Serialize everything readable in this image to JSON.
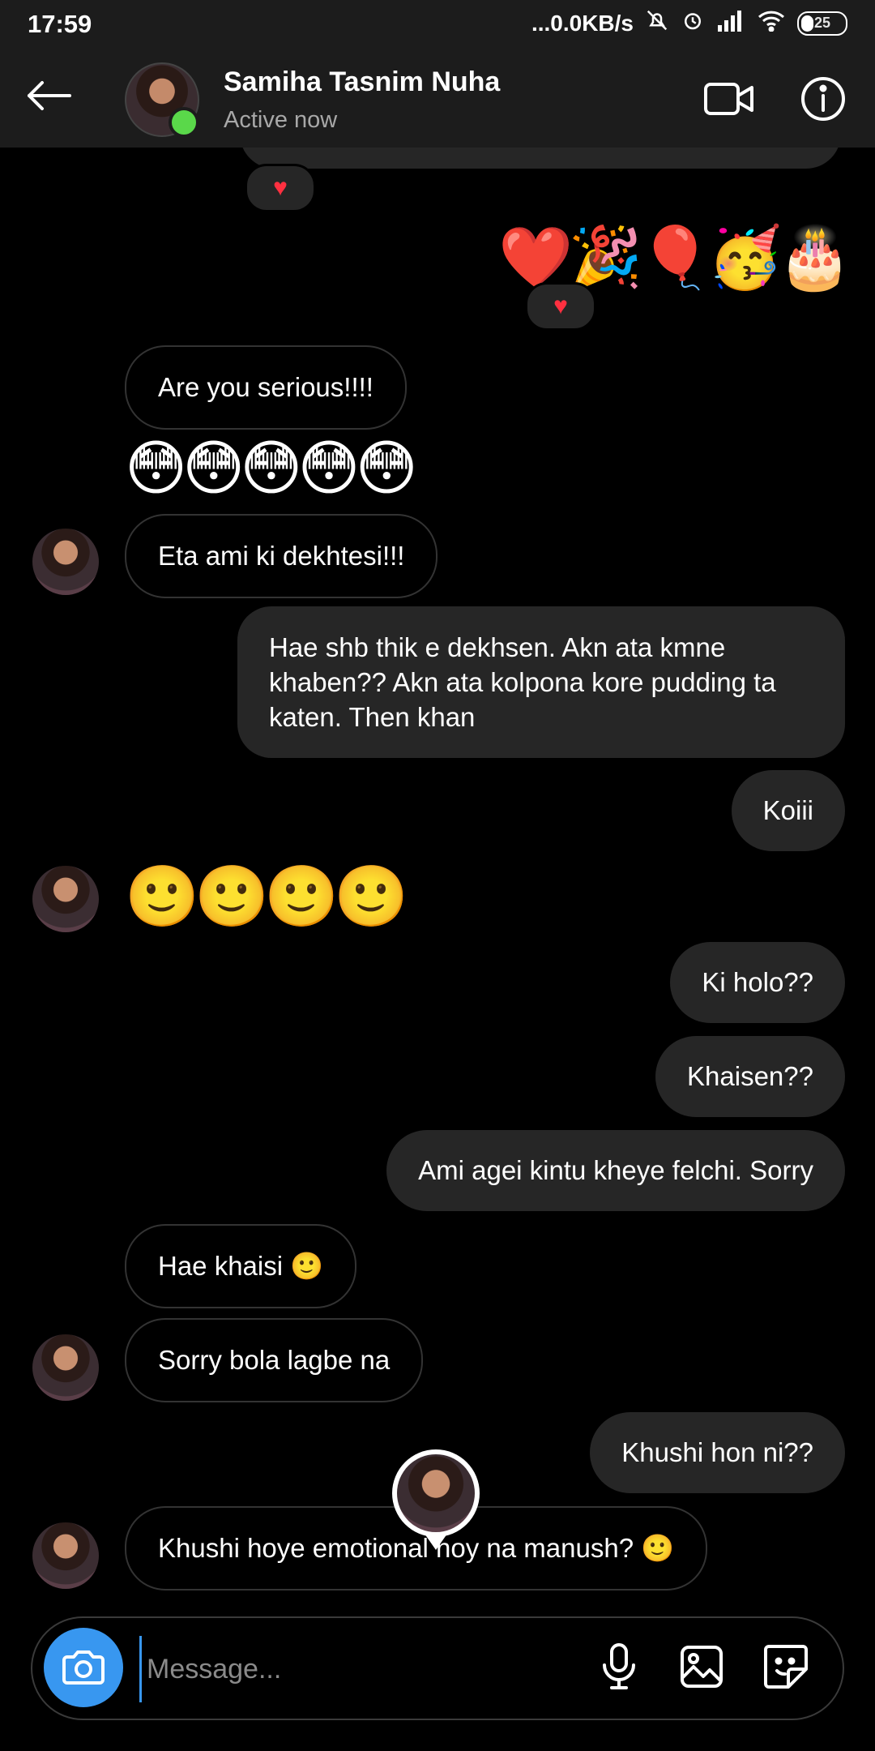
{
  "status_bar": {
    "time": "17:59",
    "network_speed": "...0.0KB/s",
    "battery": "25"
  },
  "header": {
    "name": "Samiha Tasnim Nuha",
    "status": "Active now"
  },
  "messages": {
    "reaction_1": "♥",
    "out_emojis_1": "❤️🎉🎈🥳🎂",
    "reaction_2": "♥",
    "in_1": "Are you serious!!!!",
    "in_emojis_1": "😳😳😳😳😳",
    "in_2": "Eta ami ki dekhtesi!!!",
    "out_1": "Hae shb thik e dekhsen. Akn ata kmne khaben?? Akn ata kolpona kore pudding ta katen. Then khan",
    "out_2": "Koiii",
    "in_emojis_2": "🙂🙂🙂🙂",
    "out_3": "Ki holo??",
    "out_4": "Khaisen??",
    "out_5": "Ami agei kintu kheye felchi. Sorry",
    "in_3": "Hae khaisi 🙂",
    "in_4": "Sorry bola lagbe na",
    "out_6": "Khushi hon ni??",
    "in_5": "Khushi hoye emotional hoy na manush? 🙂"
  },
  "composer": {
    "placeholder": "Message..."
  },
  "colors": {
    "background": "#000000",
    "header": "#1c1c1c",
    "outgoing_bubble": "#262626",
    "accent": "#3897f0",
    "online": "#5ad84a"
  },
  "icons": [
    "back-arrow-icon",
    "video-camera-icon",
    "info-icon",
    "camera-icon",
    "microphone-icon",
    "gallery-icon",
    "sticker-icon",
    "heart-reaction-icon"
  ]
}
